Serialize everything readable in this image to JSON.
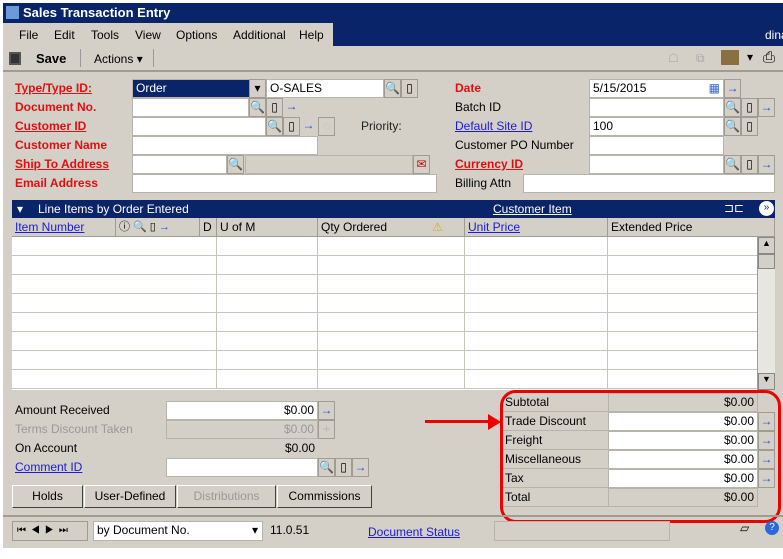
{
  "window": {
    "title": "Sales Transaction Entry",
    "user": "dina"
  },
  "menu": [
    "File",
    "Edit",
    "Tools",
    "View",
    "Options",
    "Additional",
    "Help"
  ],
  "toolbar": {
    "save": "Save",
    "actions": "Actions"
  },
  "header": {
    "type_label": "Type/Type ID:",
    "type_value": "Order",
    "type_id": "O-SALES",
    "docno_label": "Document No.",
    "custid_label": "Customer ID",
    "priority_label": "Priority:",
    "custname_label": "Customer Name",
    "shipto_label": "Ship To Address",
    "email_label": "Email Address",
    "date_label": "Date",
    "date_value": "5/15/2015",
    "batch_label": "Batch ID",
    "site_label": "Default Site ID",
    "site_value": "100",
    "po_label": "Customer PO Number",
    "currency_label": "Currency ID",
    "billing_label": "Billing Attn"
  },
  "grid": {
    "title": "Line Items by Order Entered",
    "customer_item": "Customer Item",
    "columns": {
      "item": "Item Number",
      "d": "D",
      "uom": "U of M",
      "qty": "Qty Ordered",
      "price": "Unit Price",
      "ext": "Extended Price"
    }
  },
  "payments": {
    "amount_received": "Amount Received",
    "amount_received_val": "$0.00",
    "terms_discount": "Terms Discount Taken",
    "terms_discount_val": "$0.00",
    "on_account": "On Account",
    "on_account_val": "$0.00",
    "comment_id": "Comment ID"
  },
  "buttons": {
    "holds": "Holds",
    "user_defined": "User-Defined",
    "distributions": "Distributions",
    "commissions": "Commissions"
  },
  "totals": [
    {
      "label": "Subtotal",
      "value": "$0.00"
    },
    {
      "label": "Trade Discount",
      "value": "$0.00"
    },
    {
      "label": "Freight",
      "value": "$0.00"
    },
    {
      "label": "Miscellaneous",
      "value": "$0.00"
    },
    {
      "label": "Tax",
      "value": "$0.00"
    },
    {
      "label": "Total",
      "value": "$0.00"
    }
  ],
  "status": {
    "sort": "by Document No.",
    "version": "11.0.51",
    "doc_status": "Document Status"
  },
  "colors": {
    "title_bar": "#0a246a",
    "required": "#e01010",
    "link": "#1a1adc",
    "annotation": "#ee0000"
  }
}
